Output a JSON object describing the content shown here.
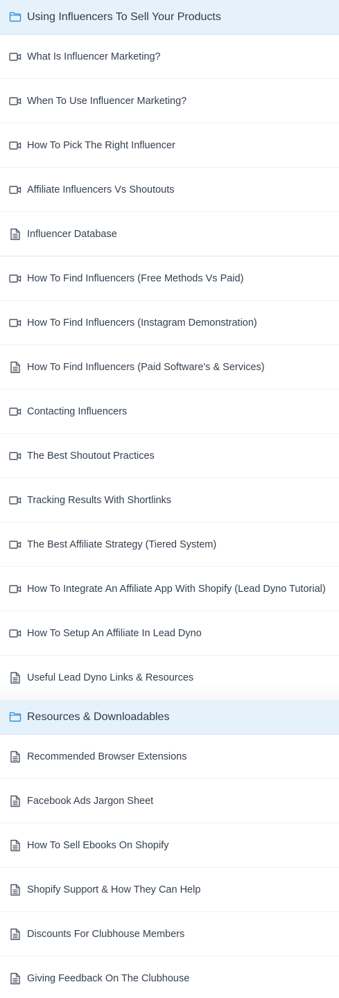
{
  "colors": {
    "section_bg": "#e6f2fb",
    "folder_icon": "#2f8fd8",
    "item_icon": "#4a5566",
    "text": "#34404f"
  },
  "sections": [
    {
      "title": "Using Influencers To Sell Your Products",
      "icon": "folder-icon",
      "items": [
        {
          "label": "What Is Influencer Marketing?",
          "icon": "video-icon"
        },
        {
          "label": "When To Use Influencer Marketing?",
          "icon": "video-icon"
        },
        {
          "label": "How To Pick The Right Influencer",
          "icon": "video-icon"
        },
        {
          "label": "Affiliate Influencers Vs Shoutouts",
          "icon": "video-icon"
        },
        {
          "label": "Influencer Database",
          "icon": "document-icon"
        },
        {
          "label": "How To Find Influencers (Free Methods Vs Paid)",
          "icon": "video-icon"
        },
        {
          "label": "How To Find Influencers (Instagram Demonstration)",
          "icon": "video-icon"
        },
        {
          "label": "How To Find Influencers (Paid Software's & Services)",
          "icon": "document-icon"
        },
        {
          "label": "Contacting Influencers",
          "icon": "video-icon"
        },
        {
          "label": "The Best Shoutout Practices",
          "icon": "video-icon"
        },
        {
          "label": "Tracking Results With Shortlinks",
          "icon": "video-icon"
        },
        {
          "label": "The Best Affiliate Strategy (Tiered System)",
          "icon": "video-icon"
        },
        {
          "label": "How To Integrate An Affiliate App With Shopify (Lead Dyno Tutorial)",
          "icon": "video-icon"
        },
        {
          "label": "How To Setup An Affiliate In Lead Dyno",
          "icon": "video-icon"
        },
        {
          "label": "Useful Lead Dyno Links & Resources",
          "icon": "document-icon"
        }
      ]
    },
    {
      "title": "Resources & Downloadables",
      "icon": "folder-icon",
      "items": [
        {
          "label": "Recommended Browser Extensions",
          "icon": "document-icon"
        },
        {
          "label": "Facebook Ads Jargon Sheet",
          "icon": "document-icon"
        },
        {
          "label": "How To Sell Ebooks On Shopify",
          "icon": "document-icon"
        },
        {
          "label": "Shopify Support & How They Can Help",
          "icon": "document-icon"
        },
        {
          "label": "Discounts For Clubhouse Members",
          "icon": "document-icon"
        },
        {
          "label": "Giving Feedback On The Clubhouse",
          "icon": "document-icon"
        }
      ]
    }
  ]
}
